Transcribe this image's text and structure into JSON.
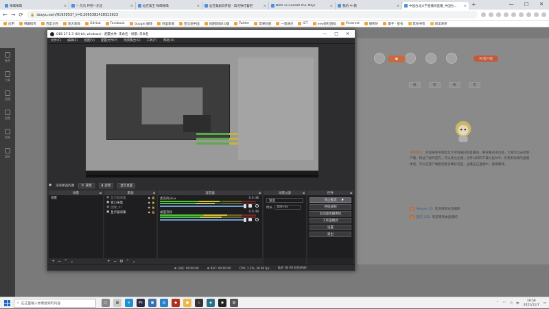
{
  "browser": {
    "tabs": [
      {
        "label": "咪喝咪喝"
      },
      {
        "label": "* ·乌乌 PP肝~乐活"
      },
      {
        "label": "仙在紫王-咪喝咪喝"
      },
      {
        "label": "仙在紫剧日开题 - 四点钟打着吧"
      },
      {
        "label": "NAVI vs GamBit PGL Majo"
      },
      {
        "label": "我的 中 韩"
      },
      {
        "label": "中国台北大学直播间直播_中国台..."
      }
    ],
    "url": "douyu.com/9193953?_t=0.2065382428313623",
    "bookmarks": [
      {
        "label": "应用"
      },
      {
        "label": "佛最搞笑"
      },
      {
        "label": "百度文档"
      },
      {
        "label": "地大新闻"
      },
      {
        "label": "GitHub"
      },
      {
        "label": "Facebook"
      },
      {
        "label": "Google 翻译"
      },
      {
        "label": "阿里新闻"
      },
      {
        "label": "亚马逊中国"
      },
      {
        "label": "同期新闻6.0版"
      },
      {
        "label": "Twitter"
      },
      {
        "label": "苹果同盘"
      },
      {
        "label": "一周速点"
      },
      {
        "label": "ICT"
      },
      {
        "label": "new新社团知"
      },
      {
        "label": "Pinterest"
      },
      {
        "label": "图所好"
      },
      {
        "label": "量子 · 星号"
      },
      {
        "label": "其他书签"
      },
      {
        "label": "阅读清单"
      }
    ]
  },
  "site": {
    "left_nav": [
      "推荐",
      "分类",
      "直播",
      "视频",
      "鱼吧",
      "我的"
    ],
    "right_icons": [
      "",
      "",
      "",
      "",
      ""
    ],
    "pc_download": "PC客户端",
    "rtabs": [
      "排",
      "贵",
      "粉",
      "活"
    ],
    "chat_text": "欢迎来到中国台北大学直播间的直播间，要在整点水位处，大家可以去到客户端，粉丝门会的官方，可以关注主播，也可以扫码下载斗鱼APP，享受更高清的直播体验，可以在客户端看到更多精彩内容，主播正在直播中，敬请期待。",
    "chat_nick": "系统提示：",
    "chat_lines": [
      {
        "badge": "1",
        "nick": "Keeper_05",
        "text": "欢迎来到本直播间"
      },
      {
        "badge": "1",
        "nick": "猫仔_255",
        "text": "欢迎来到本直播间"
      }
    ]
  },
  "obs": {
    "title": "OBS 27.1.3 (64-bit, windows) - 配置文件: 未命名 - 场景: 未命名",
    "menu": [
      "文件(F)",
      "编辑(E)",
      "视图(V)",
      "配置文件(P)",
      "场景集合(S)",
      "工具(T)",
      "帮助(H)"
    ],
    "under_preview": {
      "left": "没有所选的源",
      "props": "属性",
      "filters": "滤镜",
      "extra": "显示桌面"
    },
    "docks": {
      "scenes": {
        "title": "场景",
        "items": [
          "场景"
        ]
      },
      "sources": {
        "title": "来源",
        "items": [
          {
            "label": "显示器采集",
            "dim": true
          },
          {
            "label": "窗口采集",
            "dim": false
          },
          {
            "label": "图像_01",
            "dim": true
          },
          {
            "label": "显示器采集",
            "dim": false
          }
        ]
      },
      "mixer": {
        "title": "混音器",
        "rows": [
          {
            "name": "麦克风/Aux",
            "db": "0.0 dB",
            "level": 0.62
          },
          {
            "name": "桌面音频",
            "db": "0.0 dB",
            "level": 0.7
          }
        ]
      },
      "transitions": {
        "title": "场景过渡",
        "selected": "渐变",
        "duration_label": "时长",
        "duration": "300 ms"
      },
      "controls": {
        "title": "控件",
        "buttons": [
          "停止推流",
          "开始录制",
          "启动虚拟摄像机",
          "工作室模式",
          "设置",
          "退出"
        ]
      }
    },
    "status": {
      "live": "LIVE: 00:00:00",
      "rec": "REC: 00:00:00",
      "cpu": "CPU: 1.3%, 30.00 fps",
      "dropped": "延迟 (在 60 秒后开始)"
    }
  },
  "taskbar": {
    "search_placeholder": "在这里输入你要搜索的内容",
    "time": "19:59",
    "date": "2021/11/7"
  }
}
